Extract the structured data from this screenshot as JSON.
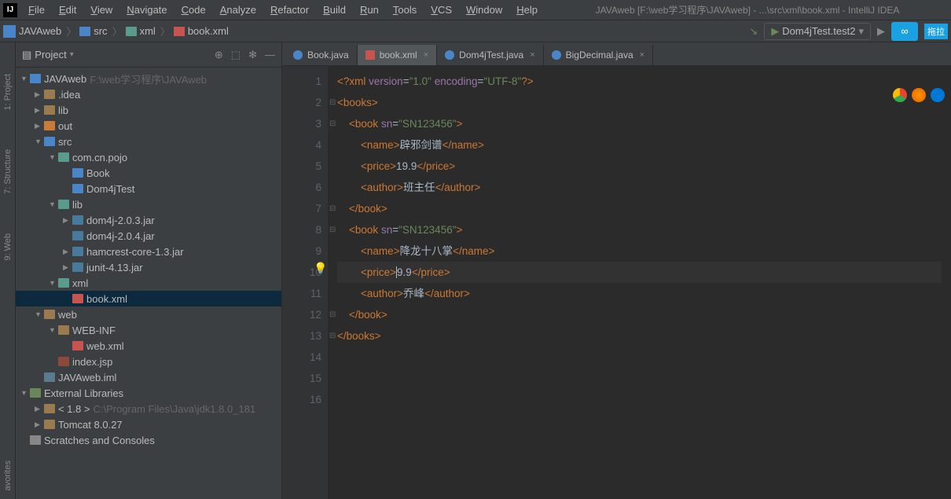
{
  "title": "JAVAweb [F:\\web学习程序\\JAVAweb] - ...\\src\\xml\\book.xml - IntelliJ IDEA",
  "menu": [
    "File",
    "Edit",
    "View",
    "Navigate",
    "Code",
    "Analyze",
    "Refactor",
    "Build",
    "Run",
    "Tools",
    "VCS",
    "Window",
    "Help"
  ],
  "breadcrumbs": [
    {
      "icon": "proj",
      "label": "JAVAweb"
    },
    {
      "icon": "folder-blue",
      "label": "src"
    },
    {
      "icon": "folder-teal",
      "label": "xml"
    },
    {
      "icon": "xml",
      "label": "book.xml"
    }
  ],
  "run_config": "Dom4jTest.test2",
  "side_panels": [
    "1: Project",
    "7: Structure",
    "9: Web",
    "avorites"
  ],
  "sidebar": {
    "title": "Project",
    "icons": [
      "target",
      "select",
      "gear",
      "hide"
    ]
  },
  "tree": [
    {
      "d": 0,
      "a": "▼",
      "ic": "proj",
      "t": "JAVAweb",
      "dim": "F:\\web学习程序\\JAVAweb"
    },
    {
      "d": 1,
      "a": "▶",
      "ic": "fold",
      "t": ".idea"
    },
    {
      "d": 1,
      "a": "▶",
      "ic": "fold",
      "t": "lib"
    },
    {
      "d": 1,
      "a": "▶",
      "ic": "fold-orange",
      "t": "out"
    },
    {
      "d": 1,
      "a": "▼",
      "ic": "fold-blue",
      "t": "src"
    },
    {
      "d": 2,
      "a": "▼",
      "ic": "fold-teal",
      "t": "com.cn.pojo"
    },
    {
      "d": 3,
      "a": "",
      "ic": "class",
      "t": "Book"
    },
    {
      "d": 3,
      "a": "",
      "ic": "class",
      "t": "Dom4jTest"
    },
    {
      "d": 2,
      "a": "▼",
      "ic": "fold-teal",
      "t": "lib"
    },
    {
      "d": 3,
      "a": "▶",
      "ic": "jar-lib",
      "t": "dom4j-2.0.3.jar"
    },
    {
      "d": 3,
      "a": "",
      "ic": "jar-lib",
      "t": "dom4j-2.0.4.jar"
    },
    {
      "d": 3,
      "a": "▶",
      "ic": "jar-lib",
      "t": "hamcrest-core-1.3.jar"
    },
    {
      "d": 3,
      "a": "▶",
      "ic": "jar-lib",
      "t": "junit-4.13.jar"
    },
    {
      "d": 2,
      "a": "▼",
      "ic": "fold-teal",
      "t": "xml"
    },
    {
      "d": 3,
      "a": "",
      "ic": "xml",
      "t": "book.xml",
      "sel": true
    },
    {
      "d": 1,
      "a": "▼",
      "ic": "fold",
      "t": "web"
    },
    {
      "d": 2,
      "a": "▼",
      "ic": "fold",
      "t": "WEB-INF"
    },
    {
      "d": 3,
      "a": "",
      "ic": "xml",
      "t": "web.xml"
    },
    {
      "d": 2,
      "a": "",
      "ic": "jsp",
      "t": "index.jsp"
    },
    {
      "d": 1,
      "a": "",
      "ic": "iml",
      "t": "JAVAweb.iml"
    },
    {
      "d": 0,
      "a": "▼",
      "ic": "lib",
      "t": "External Libraries"
    },
    {
      "d": 1,
      "a": "▶",
      "ic": "fold",
      "t": "< 1.8 >",
      "dim": "C:\\Program Files\\Java\\jdk1.8.0_181"
    },
    {
      "d": 1,
      "a": "▶",
      "ic": "fold",
      "t": "Tomcat 8.0.27"
    },
    {
      "d": 0,
      "a": "",
      "ic": "db",
      "t": "Scratches and Consoles"
    }
  ],
  "tabs": [
    {
      "ic": "java",
      "label": "Book.java",
      "close": false
    },
    {
      "ic": "xml",
      "label": "book.xml",
      "active": true,
      "close": true
    },
    {
      "ic": "java",
      "label": "Dom4jTest.java",
      "close": true
    },
    {
      "ic": "java",
      "label": "BigDecimal.java",
      "close": true
    }
  ],
  "line_numbers": [
    1,
    2,
    3,
    4,
    5,
    6,
    7,
    8,
    9,
    10,
    11,
    12,
    13,
    14,
    15,
    16
  ],
  "code": {
    "xml_decl": {
      "ver": "1.0",
      "enc": "UTF-8"
    },
    "books": [
      {
        "sn": "SN123456",
        "name": "辟邪剑谱",
        "price": "19.9",
        "author": "班主任"
      },
      {
        "sn": "SN123456",
        "name": "降龙十八掌",
        "price": "9.9",
        "author": "乔峰",
        "hl_price": true
      }
    ]
  }
}
